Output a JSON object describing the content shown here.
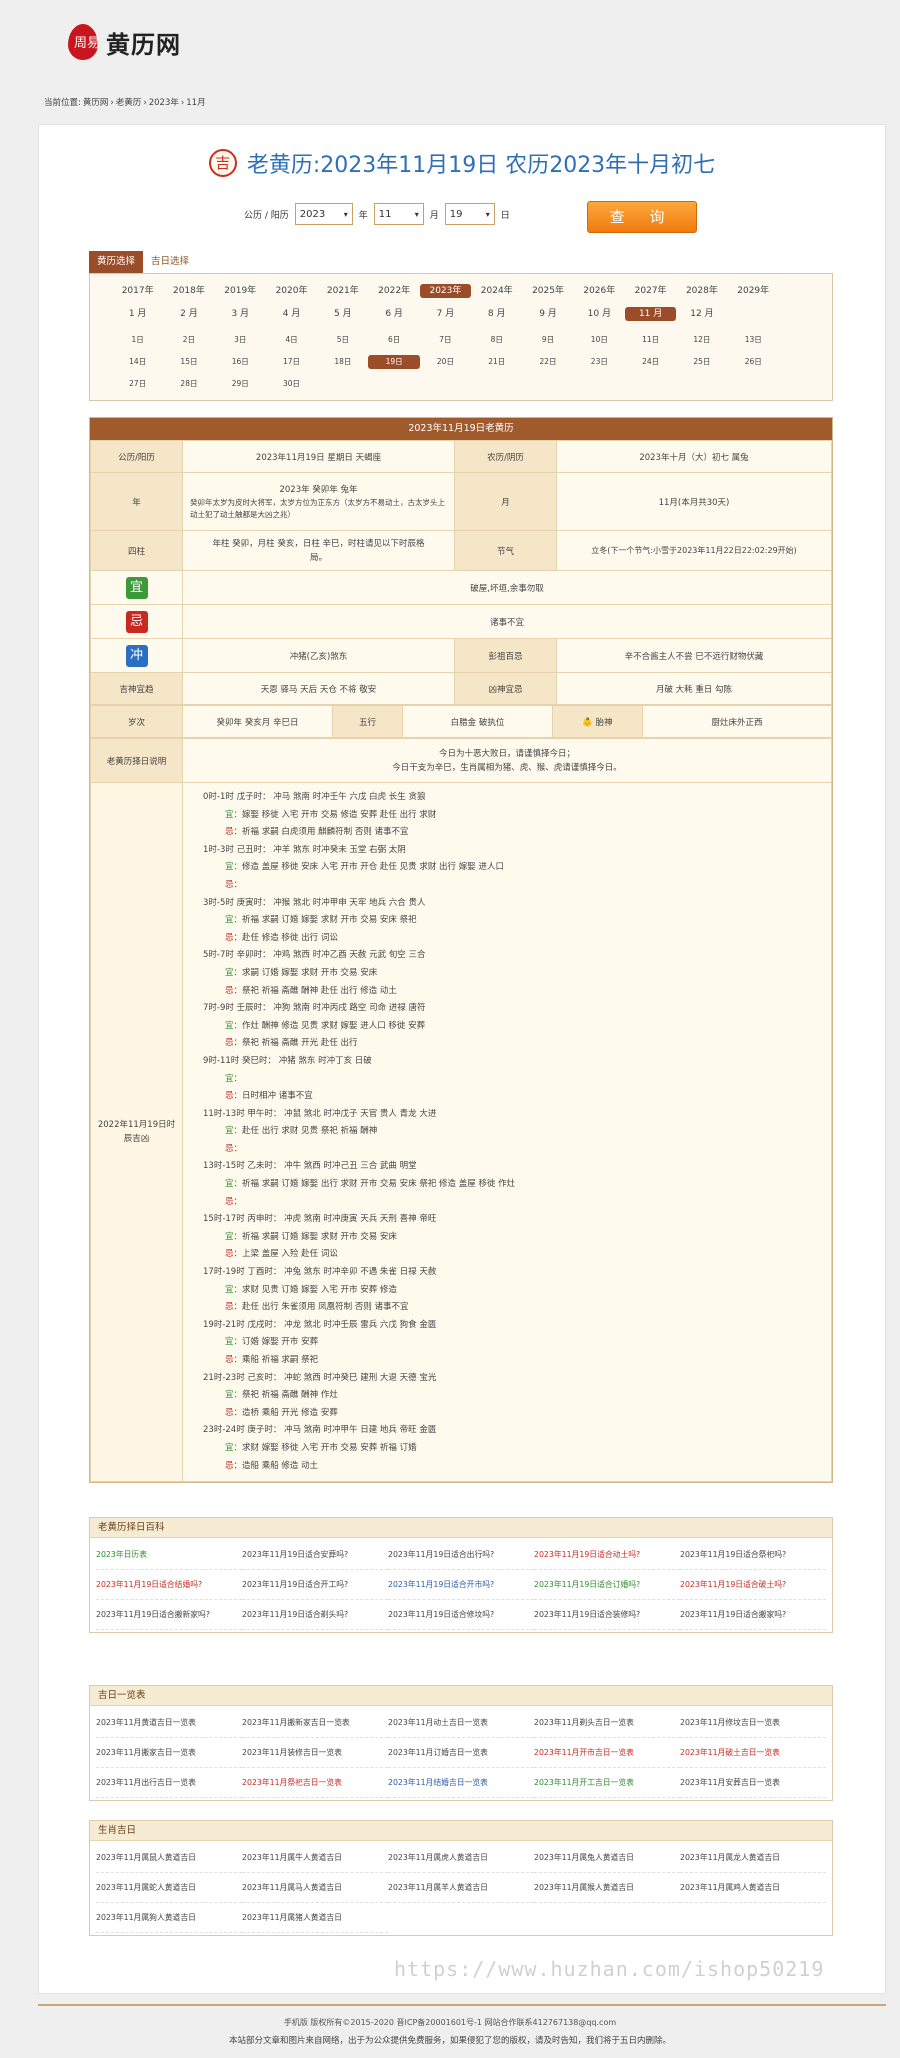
{
  "header": {
    "logo_seal_text": "周易",
    "logo_text": "黄历网"
  },
  "breadcrumb": {
    "prefix": "当前位置:",
    "items": [
      "黄历网",
      "老黄历",
      "2023年",
      "11月"
    ],
    "separator": "›"
  },
  "title": {
    "icon_char": "吉",
    "text": "老黄历:2023年11月19日 农历2023年十月初七"
  },
  "form": {
    "mode_label": "公历 / 阳历",
    "year": "2023",
    "year_unit": "年",
    "month": "11",
    "month_unit": "月",
    "day": "19",
    "day_unit": "日",
    "query_button": "查 询"
  },
  "tabs": [
    "黄历选择",
    "吉日选择"
  ],
  "calendar": {
    "years": [
      "2017年",
      "2018年",
      "2019年",
      "2020年",
      "2021年",
      "2022年",
      "2023年",
      "2024年",
      "2025年",
      "2026年",
      "2027年",
      "2028年",
      "2029年"
    ],
    "selected_year": "2023年",
    "months": [
      "1 月",
      "2 月",
      "3 月",
      "4 月",
      "5 月",
      "6 月",
      "7 月",
      "8 月",
      "9 月",
      "10 月",
      "11 月",
      "12 月"
    ],
    "selected_month": "11 月",
    "days_rows": [
      [
        "1日",
        "2日",
        "3日",
        "4日",
        "5日",
        "6日",
        "7日",
        "8日",
        "9日",
        "10日",
        "11日",
        "12日",
        "13日"
      ],
      [
        "14日",
        "15日",
        "16日",
        "17日",
        "18日",
        "19日",
        "20日",
        "21日",
        "22日",
        "23日",
        "24日",
        "25日",
        "26日"
      ],
      [
        "27日",
        "28日",
        "29日",
        "30日"
      ]
    ],
    "selected_day": "19日"
  },
  "almanac": {
    "header": "2023年11月19日老黄历",
    "gongli_label": "公历/阳历",
    "gongli_value": "2023年11月19日 星期日 天蝎座",
    "nongli_label": "农历/阴历",
    "nongli_value": "2023年十月（大）初七 属兔",
    "year_label": "年",
    "year_value_1": "2023年 癸卯年 兔年",
    "year_value_2": "癸卯年太岁为皮时大将军，太岁方位为正东方（太岁方不易动土，古太岁头上动土犯了动土触都是大凶之兆）",
    "month_label": "月",
    "month_value": "11月(本月共30天)",
    "sizhu_label": "四柱",
    "sizhu_value": "年柱 癸卯，月柱 癸亥，日柱 辛巳，时柱请见以下时辰格局。",
    "jieqi_label": "节气",
    "jieqi_value": "立冬(下一个节气:小雪于2023年11月22日22:02:29开始)",
    "yi_char": "宜",
    "yi_value": "破屋,坏垣,余事勿取",
    "ji_char": "忌",
    "ji_value": "诸事不宜",
    "chong_char": "冲",
    "chong_value": "冲猪(乙亥)煞东",
    "pengzu_label": "彭祖百忌",
    "pengzu_value": "辛不合酱主人不尝 巳不远行财物伏藏",
    "jishen_label": "吉神宜趋",
    "jishen_value": "天恩 驿马 天后 天仓 不将 敬安",
    "xiongshen_label": "凶神宜忌",
    "xiongshen_value": "月破 大耗 重日 勾陈",
    "suici_label": "岁次",
    "suici_value": "癸卯年 癸亥月 辛巳日",
    "wuxing_label": "五行",
    "wuxing_value": "白腊金 破执位",
    "taishen_label": "胎神",
    "taishen_value": "厨灶床外正西",
    "shuoming_label": "老黄历择日说明",
    "shuoming_1": "今日为十恶大败日，请谨慎择今日；",
    "shuoming_2": "今日干支为辛巳，生肖属相为猪、虎、猴、虎请谨慎择今日。",
    "shichen_label": "2022年11月19日时辰吉凶",
    "yi_prefix": "宜：",
    "ji_prefix": "忌：",
    "hours": [
      {
        "head": "0时-1时  戊子时：  冲马  煞南  时冲壬午  六戊  白虎  长生  贪狼",
        "yi": "嫁娶 移徙 入宅 开市 交易 修造 安葬 赴任 出行 求财",
        "ji": "祈福 求嗣 白虎须用 麒麟符制 否则 诸事不宜"
      },
      {
        "head": "1时-3时  己丑时：  冲羊  煞东  时冲癸未  玉堂  右弼  太阴",
        "yi": "修造 盖屋 移徙 安床 入宅 开市 开仓 赴任 见贵 求财 出行 嫁娶 进人口",
        "ji": ""
      },
      {
        "head": "3时-5时  庚寅时：  冲猴  煞北  时冲甲申  天牢  地兵  六合  贵人",
        "yi": "祈福 求嗣 订婚 嫁娶 求财 开市 交易 安床 祭祀",
        "ji": "赴任 修造 移徙 出行 词讼"
      },
      {
        "head": "5时-7时  辛卯时：  冲鸡  煞西  时冲乙酉  天赦  元武  旬空  三合",
        "yi": "求嗣 订婚 嫁娶 求财 开市 交易 安床",
        "ji": "祭祀 祈福 斋醮 酬神 赴任 出行 修造 动土"
      },
      {
        "head": "7时-9时  壬辰时：  冲狗  煞南  时冲丙戌  路空  司命  进禄  唐符",
        "yi": "作灶 酬神 修造 见贵 求财 嫁娶 进人口 移徙 安葬",
        "ji": "祭祀 祈福 斋醮 开光 赴任 出行"
      },
      {
        "head": "9时-11时  癸巳时：  冲猪  煞东  时冲丁亥  日破",
        "yi": "",
        "ji": "日时相冲 诸事不宜"
      },
      {
        "head": "11时-13时  甲午时：  冲鼠  煞北  时冲戊子  天官  贵人  青龙  大进",
        "yi": "赴任 出行 求财 见贵 祭祀 祈福 酬神",
        "ji": ""
      },
      {
        "head": "13时-15时  乙未时：  冲牛  煞西  时冲己丑  三合  武曲  明堂",
        "yi": "祈福 求嗣 订婚 嫁娶 出行 求财 开市 交易 安床 祭祀 修造 盖屋 移徙 作灶",
        "ji": ""
      },
      {
        "head": "15时-17时  丙申时：  冲虎  煞南  时冲庚寅  天兵  天刑  喜神  帝旺",
        "yi": "祈福 求嗣 订婚 嫁娶 求财 开市 交易 安床",
        "ji": "上梁 盖屋 入殓 赴任 词讼"
      },
      {
        "head": "17时-19时  丁酉时：  冲兔  煞东  时冲辛卯  不遇  朱雀  日禄  天赦",
        "yi": "求财 见贵 订婚 嫁娶 入宅 开市 安葬 修造",
        "ji": "赴任 出行 朱雀须用 凤凰符制 否则 诸事不宜"
      },
      {
        "head": "19时-21时  戊戌时：  冲龙  煞北  时冲壬辰  雷兵  六戊  狗食  金匮",
        "yi": "订婚 嫁娶 开市 安葬",
        "ji": "乘船 祈福 求嗣 祭祀"
      },
      {
        "head": "21时-23时  己亥时：  冲蛇  煞西  时冲癸巳  建刑  大退  天德  宝光",
        "yi": "祭祀 祈福 斋醮 酬神 作灶",
        "ji": "造桥 乘船 开光 修造 安葬"
      },
      {
        "head": "23时-24时  庚子时：  冲马  煞南  时冲甲午  日建  地兵  帝旺  金匮",
        "yi": "求财 嫁娶 移徙 入宅 开市 交易 安葬 祈福 订婚",
        "ji": "造船 乘船 修造 动土"
      }
    ]
  },
  "encyclopedia": {
    "title": "老黄历择日百科",
    "links": [
      {
        "t": "2023年日历表",
        "c": "g"
      },
      {
        "t": "2023年11月19日适合安葬吗?",
        "c": ""
      },
      {
        "t": "2023年11月19日适合出行吗?",
        "c": ""
      },
      {
        "t": "2023年11月19日适合动土吗?",
        "c": "r"
      },
      {
        "t": "2023年11月19日适合祭祀吗?",
        "c": ""
      },
      {
        "t": "2023年11月19日适合结婚吗?",
        "c": "r"
      },
      {
        "t": "2023年11月19日适合开工吗?",
        "c": ""
      },
      {
        "t": "2023年11月19日适合开市吗?",
        "c": "b"
      },
      {
        "t": "2023年11月19日适合订婚吗?",
        "c": "g"
      },
      {
        "t": "2023年11月19日适合破土吗?",
        "c": "r"
      },
      {
        "t": "2023年11月19日适合搬新家吗?",
        "c": ""
      },
      {
        "t": "2023年11月19日适合剃头吗?",
        "c": ""
      },
      {
        "t": "2023年11月19日适合修坟吗?",
        "c": ""
      },
      {
        "t": "2023年11月19日适合装修吗?",
        "c": ""
      },
      {
        "t": "2023年11月19日适合搬家吗?",
        "c": ""
      }
    ]
  },
  "jiri": {
    "title": "吉日一览表",
    "links": [
      {
        "t": "2023年11月黄道吉日一览表",
        "c": ""
      },
      {
        "t": "2023年11月搬新家吉日一览表",
        "c": ""
      },
      {
        "t": "2023年11月动土吉日一览表",
        "c": ""
      },
      {
        "t": "2023年11月剃头吉日一览表",
        "c": ""
      },
      {
        "t": "2023年11月修坟吉日一览表",
        "c": ""
      },
      {
        "t": "2023年11月搬家吉日一览表",
        "c": ""
      },
      {
        "t": "2023年11月装修吉日一览表",
        "c": ""
      },
      {
        "t": "2023年11月订婚吉日一览表",
        "c": ""
      },
      {
        "t": "2023年11月开市吉日一览表",
        "c": "r"
      },
      {
        "t": "2023年11月破土吉日一览表",
        "c": "r"
      },
      {
        "t": "2023年11月出行吉日一览表",
        "c": ""
      },
      {
        "t": "2023年11月祭祀吉日一览表",
        "c": "r"
      },
      {
        "t": "2023年11月结婚吉日一览表",
        "c": "b"
      },
      {
        "t": "2023年11月开工吉日一览表",
        "c": "g"
      },
      {
        "t": "2023年11月安葬吉日一览表",
        "c": ""
      }
    ]
  },
  "shengxiao": {
    "title": "生肖吉日",
    "links": [
      {
        "t": "2023年11月属鼠人黄道吉日",
        "c": ""
      },
      {
        "t": "2023年11月属牛人黄道吉日",
        "c": ""
      },
      {
        "t": "2023年11月属虎人黄道吉日",
        "c": ""
      },
      {
        "t": "2023年11月属兔人黄道吉日",
        "c": ""
      },
      {
        "t": "2023年11月属龙人黄道吉日",
        "c": ""
      },
      {
        "t": "2023年11月属蛇人黄道吉日",
        "c": ""
      },
      {
        "t": "2023年11月属马人黄道吉日",
        "c": ""
      },
      {
        "t": "2023年11月属羊人黄道吉日",
        "c": ""
      },
      {
        "t": "2023年11月属猴人黄道吉日",
        "c": ""
      },
      {
        "t": "2023年11月属鸡人黄道吉日",
        "c": ""
      },
      {
        "t": "2023年11月属狗人黄道吉日",
        "c": ""
      },
      {
        "t": "2023年11月属猪人黄道吉日",
        "c": ""
      }
    ]
  },
  "footer": {
    "line1": "手机版  版权所有©2015-2020  晋ICP备20001601号-1  网站合作联系412767138@qq.com",
    "line2": "本站部分文章和图片来自网络，出于为公众提供免费服务，如果侵犯了您的版权，请及时告知，我们将于五日内删除。"
  },
  "watermark": "https://www.huzhan.com/ishop50219"
}
